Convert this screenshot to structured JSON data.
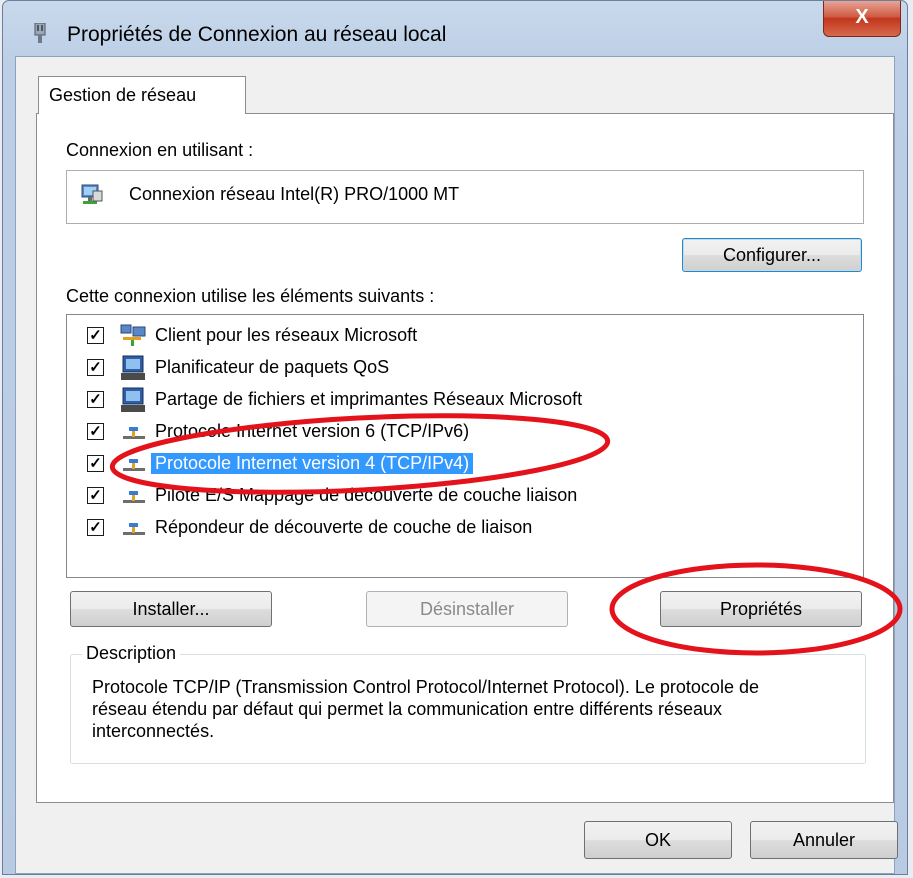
{
  "window": {
    "title": "Propriétés de Connexion au réseau local",
    "close_glyph": "X"
  },
  "tabs": [
    {
      "label": "Gestion de réseau"
    }
  ],
  "connection": {
    "label": "Connexion en utilisant :",
    "adapter": "Connexion réseau Intel(R) PRO/1000 MT",
    "configure_button": "Configurer..."
  },
  "components": {
    "label": "Cette connexion utilise les éléments suivants :",
    "items": [
      {
        "label": "Client pour les réseaux Microsoft",
        "checked": true,
        "icon": "network-client-icon"
      },
      {
        "label": "Planificateur de paquets QoS",
        "checked": true,
        "icon": "service-icon"
      },
      {
        "label": "Partage de fichiers et imprimantes Réseaux Microsoft",
        "checked": true,
        "icon": "service-icon"
      },
      {
        "label": "Protocole Internet version 6 (TCP/IPv6)",
        "checked": true,
        "icon": "protocol-icon"
      },
      {
        "label": "Protocole Internet version 4 (TCP/IPv4)",
        "checked": true,
        "icon": "protocol-icon",
        "selected": true
      },
      {
        "label": "Pilote E/S Mappage de découverte de couche liaison",
        "checked": true,
        "icon": "protocol-icon"
      },
      {
        "label": "Répondeur de découverte de couche de liaison",
        "checked": true,
        "icon": "protocol-icon"
      }
    ],
    "check_glyph": "✓"
  },
  "actions": {
    "install": "Installer...",
    "uninstall": "Désinstaller",
    "properties": "Propriétés"
  },
  "description": {
    "legend": "Description",
    "text": "Protocole TCP/IP (Transmission Control Protocol/Internet Protocol). Le protocole de réseau étendu par défaut qui permet la communication entre différents réseaux interconnectés."
  },
  "footer": {
    "ok": "OK",
    "cancel": "Annuler"
  },
  "colors": {
    "selection": "#3399ff",
    "annotation": "#e3121b",
    "close_button": "#c2361c"
  }
}
